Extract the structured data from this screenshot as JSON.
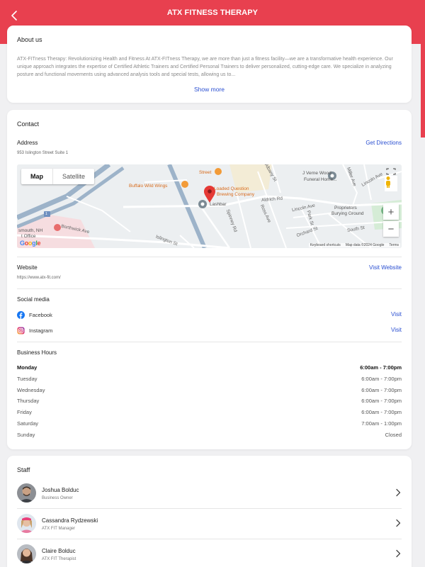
{
  "header": {
    "title": "ATX FITNESS THERAPY",
    "back_icon": "chevron-left-icon",
    "color": "#e8404f"
  },
  "about": {
    "heading": "About us",
    "text": "ATX-FITness Therapy: Revolutionizing Health and Fitness At ATX-FITness Therapy, we are more than just a fitness facility—we are a transformative health experience. Our unique approach integrates the expertise of Certified Athletic Trainers and Certified Personal Trainers to deliver personalized, cutting-edge care. We specialize in analyzing posture and functional movements using advanced analysis tools and special tests, allowing us to...",
    "show_more": "Show more"
  },
  "contact": {
    "heading": "Contact",
    "address_label": "Address",
    "address": "953 Islington Street Suite 1",
    "get_directions": "Get Directions",
    "map": {
      "map_tab": "Map",
      "satellite_tab": "Satellite",
      "zoom_in": "+",
      "zoom_out": "−",
      "attribution_shortcuts": "Keyboard shortcuts",
      "attribution_data": "Map data ©2024 Google",
      "attribution_terms": "Terms",
      "google": "Google",
      "labels": {
        "street": "Street",
        "buffalo": "Buffalo Wild Wings",
        "loaded1": "Loaded Question",
        "loaded2": "Brewing Company",
        "lashbar": "Lashbar",
        "jverne1": "J Verne Wood",
        "jverne2": "Funeral Home...",
        "proprietors1": "Proprietors",
        "proprietors2": "Burying Ground",
        "portsmouth1": "smouth, NH",
        "portsmouth2": "t Office",
        "islington": "Islington St",
        "aldrich": "Aldrich Rd",
        "lincoln_ave": "Lincoln Ave",
        "lincoln_ave2": "Lincoln Ave",
        "south_st": "South St",
        "orchard": "Orchard St",
        "park": "Park St",
        "miller": "Miller Ave",
        "albany": "Albany St",
        "spinney": "Spinney Rd",
        "ross": "Ross Ave",
        "borthwick": "Borthwick Ave",
        "route": "1"
      }
    },
    "website_label": "Website",
    "website_url": "https://www.atx-fit.com/",
    "visit_website": "Visit Website",
    "social_label": "Social media",
    "social": [
      {
        "name": "Facebook",
        "action": "Visit",
        "icon": "facebook-icon"
      },
      {
        "name": "Instagram",
        "action": "Visit",
        "icon": "instagram-icon"
      }
    ],
    "hours_label": "Business Hours",
    "hours": [
      {
        "day": "Monday",
        "time": "6:00am - 7:00pm",
        "current": true
      },
      {
        "day": "Tuesday",
        "time": "6:00am - 7:00pm"
      },
      {
        "day": "Wednesday",
        "time": "6:00am - 7:00pm"
      },
      {
        "day": "Thursday",
        "time": "6:00am - 7:00pm"
      },
      {
        "day": "Friday",
        "time": "6:00am - 7:00pm"
      },
      {
        "day": "Saturday",
        "time": "7:00am - 1:00pm"
      },
      {
        "day": "Sunday",
        "time": "Closed"
      }
    ]
  },
  "staff": {
    "heading": "Staff",
    "members": [
      {
        "name": "Joshua Bolduc",
        "role": "Business Owner"
      },
      {
        "name": "Cassandra Rydzewski",
        "role": "ATX FIT Manager"
      },
      {
        "name": "Claire Bolduc",
        "role": "ATX FIT Therapist"
      }
    ]
  },
  "colors": {
    "accent": "#e8404f",
    "link": "#2a4fd1",
    "marker": "#e53935"
  }
}
